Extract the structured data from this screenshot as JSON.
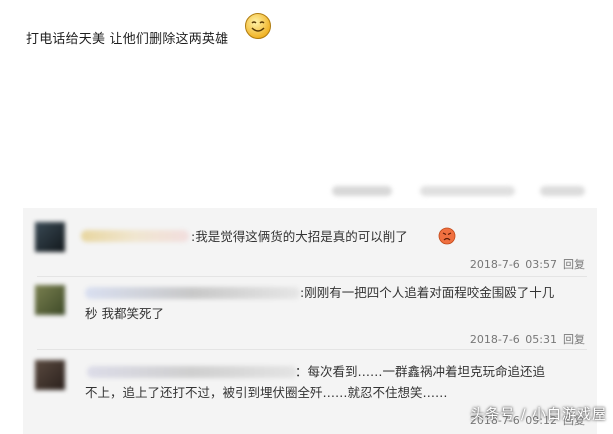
{
  "post": {
    "text": "打电话给天美 让他们删除这两英雄",
    "emoji": "smiley-emoji"
  },
  "comments": [
    {
      "text": ":我是觉得这俩货的大招是真的可以削了",
      "emoji": "angry-emoji",
      "date": "2018-7-6 03:57",
      "reply": "回复"
    },
    {
      "text_line1": ":刚刚有一把四个人追着对面程咬金围殴了十几",
      "text_line2": "秒 我都笑死了",
      "date": "2018-7-6 05:31",
      "reply": "回复"
    },
    {
      "text_line1": "：每次看到……一群鑫祸冲着坦克玩命追还追",
      "text_line2": "不上，追上了还打不过，被引到埋伏圈全歼……就忍不住想笑……",
      "date": "2018-7-6 09:12",
      "reply": "回复"
    }
  ],
  "watermark": "头条号 / 小白游戏屋"
}
